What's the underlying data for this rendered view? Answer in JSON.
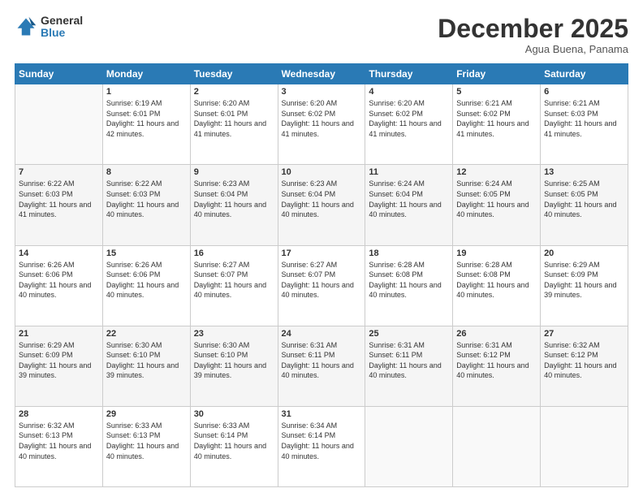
{
  "logo": {
    "general": "General",
    "blue": "Blue"
  },
  "header": {
    "month": "December 2025",
    "location": "Agua Buena, Panama"
  },
  "weekdays": [
    "Sunday",
    "Monday",
    "Tuesday",
    "Wednesday",
    "Thursday",
    "Friday",
    "Saturday"
  ],
  "weeks": [
    [
      {
        "day": "",
        "sunrise": "",
        "sunset": "",
        "daylight": ""
      },
      {
        "day": "1",
        "sunrise": "Sunrise: 6:19 AM",
        "sunset": "Sunset: 6:01 PM",
        "daylight": "Daylight: 11 hours and 42 minutes."
      },
      {
        "day": "2",
        "sunrise": "Sunrise: 6:20 AM",
        "sunset": "Sunset: 6:01 PM",
        "daylight": "Daylight: 11 hours and 41 minutes."
      },
      {
        "day": "3",
        "sunrise": "Sunrise: 6:20 AM",
        "sunset": "Sunset: 6:02 PM",
        "daylight": "Daylight: 11 hours and 41 minutes."
      },
      {
        "day": "4",
        "sunrise": "Sunrise: 6:20 AM",
        "sunset": "Sunset: 6:02 PM",
        "daylight": "Daylight: 11 hours and 41 minutes."
      },
      {
        "day": "5",
        "sunrise": "Sunrise: 6:21 AM",
        "sunset": "Sunset: 6:02 PM",
        "daylight": "Daylight: 11 hours and 41 minutes."
      },
      {
        "day": "6",
        "sunrise": "Sunrise: 6:21 AM",
        "sunset": "Sunset: 6:03 PM",
        "daylight": "Daylight: 11 hours and 41 minutes."
      }
    ],
    [
      {
        "day": "7",
        "sunrise": "Sunrise: 6:22 AM",
        "sunset": "Sunset: 6:03 PM",
        "daylight": "Daylight: 11 hours and 41 minutes."
      },
      {
        "day": "8",
        "sunrise": "Sunrise: 6:22 AM",
        "sunset": "Sunset: 6:03 PM",
        "daylight": "Daylight: 11 hours and 40 minutes."
      },
      {
        "day": "9",
        "sunrise": "Sunrise: 6:23 AM",
        "sunset": "Sunset: 6:04 PM",
        "daylight": "Daylight: 11 hours and 40 minutes."
      },
      {
        "day": "10",
        "sunrise": "Sunrise: 6:23 AM",
        "sunset": "Sunset: 6:04 PM",
        "daylight": "Daylight: 11 hours and 40 minutes."
      },
      {
        "day": "11",
        "sunrise": "Sunrise: 6:24 AM",
        "sunset": "Sunset: 6:04 PM",
        "daylight": "Daylight: 11 hours and 40 minutes."
      },
      {
        "day": "12",
        "sunrise": "Sunrise: 6:24 AM",
        "sunset": "Sunset: 6:05 PM",
        "daylight": "Daylight: 11 hours and 40 minutes."
      },
      {
        "day": "13",
        "sunrise": "Sunrise: 6:25 AM",
        "sunset": "Sunset: 6:05 PM",
        "daylight": "Daylight: 11 hours and 40 minutes."
      }
    ],
    [
      {
        "day": "14",
        "sunrise": "Sunrise: 6:26 AM",
        "sunset": "Sunset: 6:06 PM",
        "daylight": "Daylight: 11 hours and 40 minutes."
      },
      {
        "day": "15",
        "sunrise": "Sunrise: 6:26 AM",
        "sunset": "Sunset: 6:06 PM",
        "daylight": "Daylight: 11 hours and 40 minutes."
      },
      {
        "day": "16",
        "sunrise": "Sunrise: 6:27 AM",
        "sunset": "Sunset: 6:07 PM",
        "daylight": "Daylight: 11 hours and 40 minutes."
      },
      {
        "day": "17",
        "sunrise": "Sunrise: 6:27 AM",
        "sunset": "Sunset: 6:07 PM",
        "daylight": "Daylight: 11 hours and 40 minutes."
      },
      {
        "day": "18",
        "sunrise": "Sunrise: 6:28 AM",
        "sunset": "Sunset: 6:08 PM",
        "daylight": "Daylight: 11 hours and 40 minutes."
      },
      {
        "day": "19",
        "sunrise": "Sunrise: 6:28 AM",
        "sunset": "Sunset: 6:08 PM",
        "daylight": "Daylight: 11 hours and 40 minutes."
      },
      {
        "day": "20",
        "sunrise": "Sunrise: 6:29 AM",
        "sunset": "Sunset: 6:09 PM",
        "daylight": "Daylight: 11 hours and 39 minutes."
      }
    ],
    [
      {
        "day": "21",
        "sunrise": "Sunrise: 6:29 AM",
        "sunset": "Sunset: 6:09 PM",
        "daylight": "Daylight: 11 hours and 39 minutes."
      },
      {
        "day": "22",
        "sunrise": "Sunrise: 6:30 AM",
        "sunset": "Sunset: 6:10 PM",
        "daylight": "Daylight: 11 hours and 39 minutes."
      },
      {
        "day": "23",
        "sunrise": "Sunrise: 6:30 AM",
        "sunset": "Sunset: 6:10 PM",
        "daylight": "Daylight: 11 hours and 39 minutes."
      },
      {
        "day": "24",
        "sunrise": "Sunrise: 6:31 AM",
        "sunset": "Sunset: 6:11 PM",
        "daylight": "Daylight: 11 hours and 40 minutes."
      },
      {
        "day": "25",
        "sunrise": "Sunrise: 6:31 AM",
        "sunset": "Sunset: 6:11 PM",
        "daylight": "Daylight: 11 hours and 40 minutes."
      },
      {
        "day": "26",
        "sunrise": "Sunrise: 6:31 AM",
        "sunset": "Sunset: 6:12 PM",
        "daylight": "Daylight: 11 hours and 40 minutes."
      },
      {
        "day": "27",
        "sunrise": "Sunrise: 6:32 AM",
        "sunset": "Sunset: 6:12 PM",
        "daylight": "Daylight: 11 hours and 40 minutes."
      }
    ],
    [
      {
        "day": "28",
        "sunrise": "Sunrise: 6:32 AM",
        "sunset": "Sunset: 6:13 PM",
        "daylight": "Daylight: 11 hours and 40 minutes."
      },
      {
        "day": "29",
        "sunrise": "Sunrise: 6:33 AM",
        "sunset": "Sunset: 6:13 PM",
        "daylight": "Daylight: 11 hours and 40 minutes."
      },
      {
        "day": "30",
        "sunrise": "Sunrise: 6:33 AM",
        "sunset": "Sunset: 6:14 PM",
        "daylight": "Daylight: 11 hours and 40 minutes."
      },
      {
        "day": "31",
        "sunrise": "Sunrise: 6:34 AM",
        "sunset": "Sunset: 6:14 PM",
        "daylight": "Daylight: 11 hours and 40 minutes."
      },
      {
        "day": "",
        "sunrise": "",
        "sunset": "",
        "daylight": ""
      },
      {
        "day": "",
        "sunrise": "",
        "sunset": "",
        "daylight": ""
      },
      {
        "day": "",
        "sunrise": "",
        "sunset": "",
        "daylight": ""
      }
    ]
  ]
}
